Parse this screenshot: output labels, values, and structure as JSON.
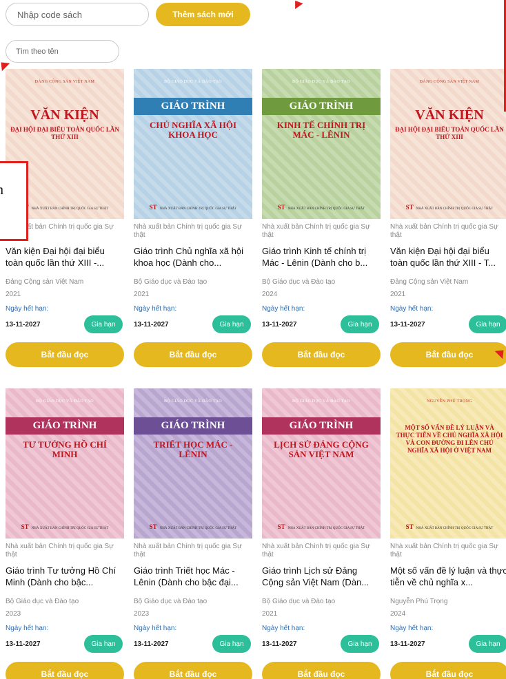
{
  "toolbar": {
    "code_placeholder": "Nhập code sách",
    "add_label": "Thêm sách mới",
    "name_placeholder": "Tìm theo tên"
  },
  "annotation": {
    "char": "n"
  },
  "books": [
    {
      "cover": {
        "theme": "pink",
        "top": "ĐẢNG CỘNG SẢN VIỆT NAM",
        "title": "VĂN KIỆN",
        "subtitle": "ĐẠI HỘI ĐẠI BIỂU TOÀN QUỐC LẦN THỨ XIII",
        "footer": "NHÀ XUẤT BẢN CHÍNH TRỊ QUỐC GIA SỰ THẬT"
      },
      "publisher": "Nhà xuất bản Chính trị quốc gia Sự thật",
      "title": "Văn kiện Đại hội đại biểu toàn quốc lần thứ XIII -...",
      "author": "Đảng Cộng sản Việt Nam",
      "year": "2021",
      "expiry_label": "Ngày hết hạn:",
      "expiry_date": "13-11-2027",
      "renew_label": "Gia hạn",
      "read_label": "Bắt đầu đọc"
    },
    {
      "cover": {
        "theme": "blue",
        "top": "BỘ GIÁO DỤC VÀ ĐÀO TẠO",
        "banner": "GIÁO TRÌNH",
        "title": "CHỦ NGHĨA XÃ HỘI KHOA HỌC",
        "footer": "NHÀ XUẤT BẢN CHÍNH TRỊ QUỐC GIA SỰ THẬT"
      },
      "publisher": "Nhà xuất bản Chính trị quốc gia Sự thật",
      "title": "Giáo trình Chủ nghĩa xã hội khoa học (Dành cho...",
      "author": "Bộ Giáo dục và Đào tạo",
      "year": "2021",
      "expiry_label": "Ngày hết hạn:",
      "expiry_date": "13-11-2027",
      "renew_label": "Gia hạn",
      "read_label": "Bắt đầu đọc"
    },
    {
      "cover": {
        "theme": "green",
        "top": "BỘ GIÁO DỤC VÀ ĐÀO TẠO",
        "banner": "GIÁO TRÌNH",
        "title": "KINH TẾ CHÍNH TRỊ MÁC - LÊNIN",
        "footer": "NHÀ XUẤT BẢN CHÍNH TRỊ QUỐC GIA SỰ THẬT"
      },
      "publisher": "Nhà xuất bản Chính trị quốc gia Sự thật",
      "title": "Giáo trình Kinh tế chính trị Mác - Lênin (Dành cho b...",
      "author": "Bộ Giáo dục và Đào tạo",
      "year": "2024",
      "expiry_label": "Ngày hết hạn:",
      "expiry_date": "13-11-2027",
      "renew_label": "Gia hạn",
      "read_label": "Bắt đầu đọc"
    },
    {
      "cover": {
        "theme": "pink",
        "top": "ĐẢNG CỘNG SẢN VIỆT NAM",
        "title": "VĂN KIỆN",
        "subtitle": "ĐẠI HỘI ĐẠI BIỂU TOÀN QUỐC LẦN THỨ XIII",
        "footer": "NHÀ XUẤT BẢN CHÍNH TRỊ QUỐC GIA SỰ THẬT"
      },
      "publisher": "Nhà xuất bản Chính trị quốc gia Sự thật",
      "title": "Văn kiện Đại hội đại biểu toàn quốc lần thứ XIII - T...",
      "author": "Đảng Cộng sản Việt Nam",
      "year": "2021",
      "expiry_label": "Ngày hết hạn:",
      "expiry_date": "13-11-2027",
      "renew_label": "Gia hạn",
      "read_label": "Bắt đầu đọc"
    },
    {
      "cover": {
        "theme": "magenta",
        "top": "BỘ GIÁO DỤC VÀ ĐÀO TẠO",
        "banner": "GIÁO TRÌNH",
        "title": "TƯ TƯỞNG HỒ CHÍ MINH",
        "footer": "NHÀ XUẤT BẢN CHÍNH TRỊ QUỐC GIA SỰ THẬT"
      },
      "publisher": "Nhà xuất bản Chính trị quốc gia Sự thật",
      "title": "Giáo trình Tư tưởng Hồ Chí Minh (Dành cho bậc...",
      "author": "Bộ Giáo dục và Đào tạo",
      "year": "2023",
      "expiry_label": "Ngày hết hạn:",
      "expiry_date": "13-11-2027",
      "renew_label": "Gia hạn",
      "read_label": "Bắt đầu đọc"
    },
    {
      "cover": {
        "theme": "purple",
        "top": "BỘ GIÁO DỤC VÀ ĐÀO TẠO",
        "banner": "GIÁO TRÌNH",
        "title": "TRIẾT HỌC MÁC - LÊNIN",
        "footer": "NHÀ XUẤT BẢN CHÍNH TRỊ QUỐC GIA SỰ THẬT"
      },
      "publisher": "Nhà xuất bản Chính trị quốc gia Sự thật",
      "title": "Giáo trình Triết học Mác - Lênin (Dành cho bậc đại...",
      "author": "Bộ Giáo dục và Đào tạo",
      "year": "2023",
      "expiry_label": "Ngày hết hạn:",
      "expiry_date": "13-11-2027",
      "renew_label": "Gia hạn",
      "read_label": "Bắt đầu đọc"
    },
    {
      "cover": {
        "theme": "magenta",
        "top": "BỘ GIÁO DỤC VÀ ĐÀO TẠO",
        "banner": "GIÁO TRÌNH",
        "title": "LỊCH SỬ ĐẢNG CỘNG SẢN VIỆT NAM",
        "footer": "NHÀ XUẤT BẢN CHÍNH TRỊ QUỐC GIA SỰ THẬT"
      },
      "publisher": "Nhà xuất bản Chính trị quốc gia Sự thật",
      "title": "Giáo trình Lịch sử Đảng Cộng sản Việt Nam (Dàn...",
      "author": "Bộ Giáo dục và Đào tạo",
      "year": "2021",
      "expiry_label": "Ngày hết hạn:",
      "expiry_date": "13-11-2027",
      "renew_label": "Gia hạn",
      "read_label": "Bắt đầu đọc"
    },
    {
      "cover": {
        "theme": "cream",
        "top": "NGUYỄN PHÚ TRỌNG",
        "title": "MỘT SỐ VẤN ĐỀ LÝ LUẬN VÀ THỰC TIỄN VỀ CHỦ NGHĨA XÃ HỘI VÀ CON ĐƯỜNG ĐI LÊN CHỦ NGHĨA XÃ HỘI Ở VIỆT NAM",
        "footer": "NHÀ XUẤT BẢN CHÍNH TRỊ QUỐC GIA SỰ THẬT"
      },
      "publisher": "Nhà xuất bản Chính trị quốc gia Sự thật",
      "title": "Một số vấn đề lý luận và thực tiễn về chủ nghĩa x...",
      "author": "Nguyễn Phú Trọng",
      "year": "2024",
      "expiry_label": "Ngày hết hạn:",
      "expiry_date": "13-11-2027",
      "renew_label": "Gia hạn",
      "read_label": "Bắt đầu đọc"
    }
  ],
  "colors": {
    "accent": "#e6b81f",
    "renew": "#2dbf9a",
    "link": "#2a6db5",
    "annotation": "#e0201c"
  }
}
